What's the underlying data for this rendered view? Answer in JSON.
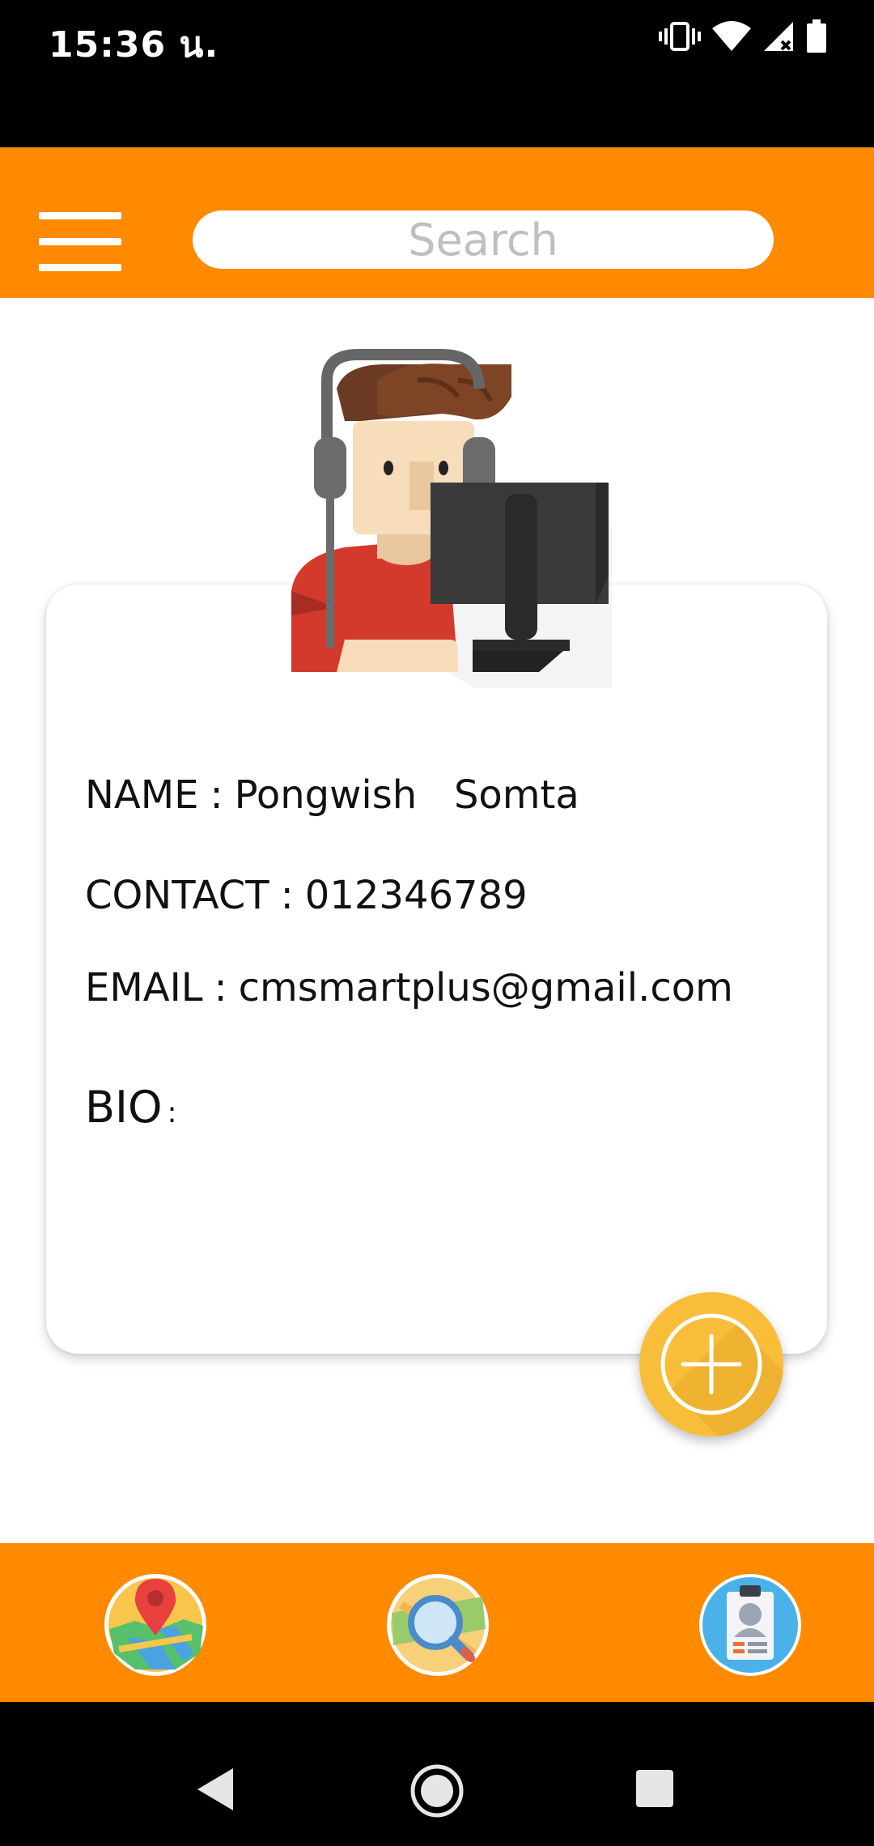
{
  "status_bar": {
    "time": "15:36 น.",
    "icons": [
      "vibrate-icon",
      "wifi-icon",
      "signal-icon",
      "battery-icon"
    ]
  },
  "header": {
    "menu_icon": "hamburger-menu-icon",
    "search_placeholder": "Search"
  },
  "profile": {
    "avatar_icon": "user-at-computer-avatar-icon",
    "name_label": "NAME",
    "name_value": "Pongwish   Somta",
    "contact_label": "CONTACT",
    "contact_value": "012346789",
    "email_label": "EMAIL",
    "email_value": "cmsmartplus@gmail.com",
    "bio_label": "BIO",
    "bio_value": "",
    "separator": ":"
  },
  "fab": {
    "icon": "add-circle-icon"
  },
  "bottom_nav": [
    {
      "icon": "map-pin-icon"
    },
    {
      "icon": "map-search-icon"
    },
    {
      "icon": "id-card-icon"
    }
  ],
  "system_nav": [
    "back-icon",
    "home-icon",
    "recents-icon"
  ],
  "colors": {
    "primary": "#FF8A00",
    "fab": "#F8BE3A",
    "status_bar": "#000000",
    "card": "#FFFFFF"
  }
}
